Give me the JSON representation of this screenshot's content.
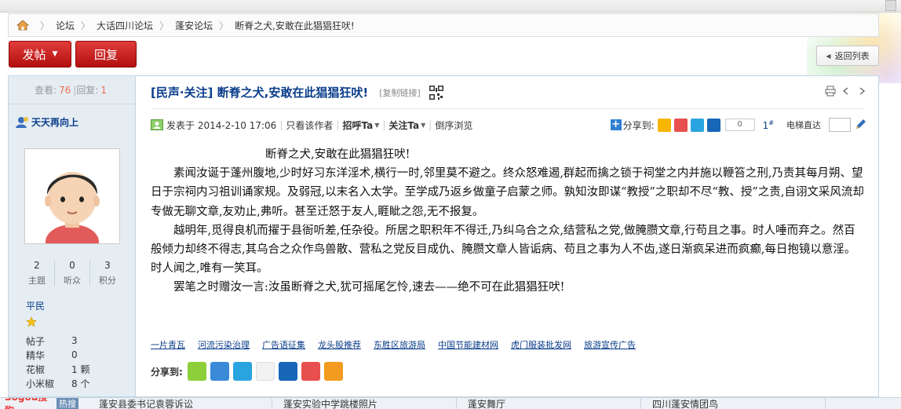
{
  "breadcrumb": {
    "home_icon": "home-icon",
    "items": [
      "论坛",
      "大话四川论坛",
      "蓬安论坛",
      "断脊之犬,安敢在此猖猖狂吠!"
    ]
  },
  "actions": {
    "post": "发帖",
    "reply": "回复",
    "back": "返回列表"
  },
  "sidebar": {
    "views_label": "查看:",
    "views": "76",
    "replies_label": "回复:",
    "replies": "1",
    "username": "天天再向上",
    "counts": [
      {
        "value": "2",
        "label": "主题"
      },
      {
        "value": "0",
        "label": "听众"
      },
      {
        "value": "3",
        "label": "积分"
      }
    ],
    "rank": "平民",
    "stats": [
      {
        "label": "帖子",
        "value": "3"
      },
      {
        "label": "精华",
        "value": "0"
      },
      {
        "label": "花椒",
        "value": "1 颗"
      },
      {
        "label": "小米椒",
        "value": "8 个"
      }
    ]
  },
  "post": {
    "title": "[民声·关注] 断脊之犬,安敢在此猖猖狂吠!",
    "copy_link": "[复制链接]",
    "posted_at": "发表于 2014-2-10 17:06",
    "only_author": "只看该作者",
    "greet": "招呼Ta",
    "follow": "关注Ta",
    "reverse": "倒序浏览",
    "share_label": "分享到:",
    "share_count": "0",
    "floor": "1",
    "floor_mark": "#",
    "lift_label": "电梯直达",
    "headline": "断脊之犬,安敢在此猖猖狂吠!",
    "paragraphs": [
      "素闻汝诞于蓬州腹地,少时好习东洋淫术,横行一时,邻里莫不避之。终众怒难遏,群起而擒之锁于祠堂之内并施以鞭笞之刑,乃责其每月朔、望日于宗祠内习祖训诵家规。及弱冠,以末名入太学。至学成乃返乡做童子启蒙之师。孰知汝即谋“教授”之职却不尽“教、授”之责,自诩文采风流却专做无聊文章,友劝止,弗听。甚至迁怒于友人,睚眦之怨,无不报复。",
      "越明年,觅得良机而擢于县衙听差,任杂役。所居之职积年不得迁,乃纠乌合之众,结营私之党,做腌臜文章,行苟且之事。时人唾而弃之。然百般倾力却终不得志,其乌合之众作鸟兽散、营私之党反目成仇、腌臜文章人皆诟病、苟且之事为人不齿,遂日渐疯呆进而疯癫,每日抱镜以意淫。时人闻之,唯有一笑耳。",
      "罢笔之时赠汝一言:汝虽断脊之犬,犹可摇尾乞怜,速去——绝不可在此猖猖狂吠!"
    ],
    "ad_links": [
      "一片青瓦",
      "河流污染治理",
      "广告语征集",
      "龙头股推荐",
      "东胜区旅游局",
      "中国节能建材网",
      "虎门服装批发网",
      "旅游宣传广告"
    ],
    "share_bottom_label": "分享到:"
  },
  "bottombar": {
    "brand": "Sogou搜狗",
    "tag": "热搜",
    "items": [
      "蓬安县委书记袁蓉诉讼",
      "蓬安实验中学跳楼照片",
      "蓬安舞厅",
      "四川蓬安情团鸟"
    ]
  },
  "colors": {
    "accent": "#0a3d8a",
    "button_red": "#c81e1e",
    "sidebar_bg": "#e5edf2"
  }
}
